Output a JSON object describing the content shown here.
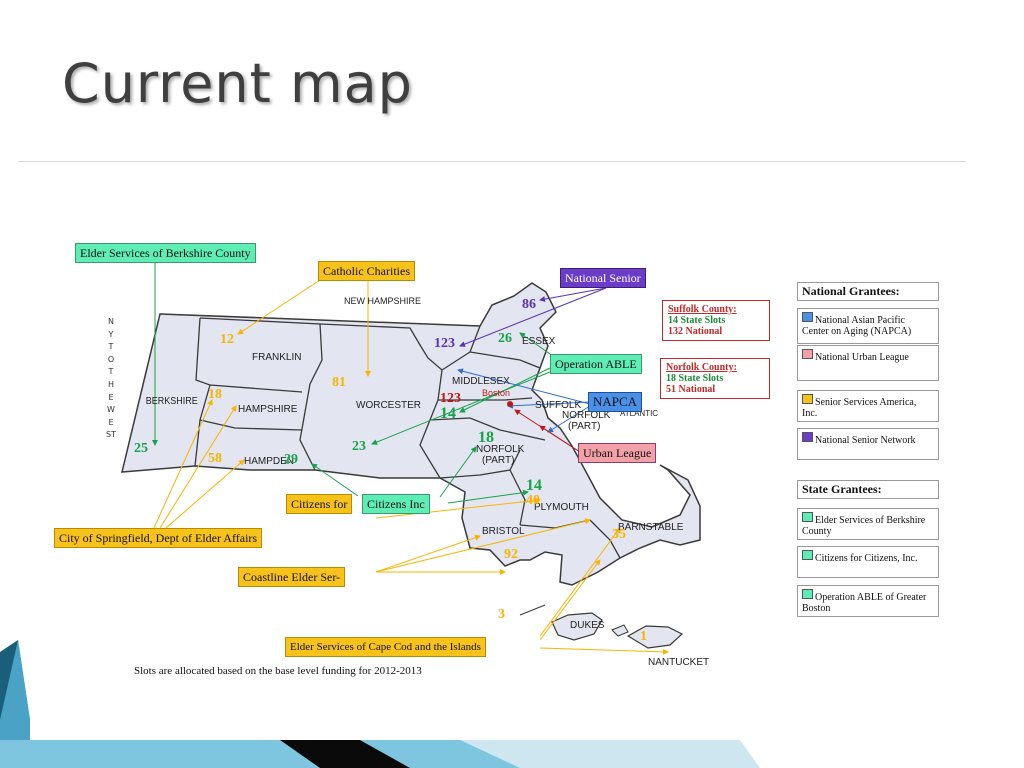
{
  "slide": {
    "title": "Current map"
  },
  "map": {
    "ny_west": "NY TO THE WEST",
    "counties": {
      "berkshire": "BERKSHIRE",
      "franklin": "FRANKLIN",
      "hampshire": "HAMPSHIRE",
      "hampden": "HAMPDEN",
      "worcester": "WORCESTER",
      "middlesex": "MIDDLESEX",
      "essex": "ESSEX",
      "suffolk": "SUFFOLK",
      "norfolk_part_top": "NORFOLK\n(PART)",
      "norfolk_part": "NORFOLK\n(PART)",
      "plymouth": "PLYMOUTH",
      "bristol": "BRISTOL",
      "barnstable": "BARNSTABLE",
      "dukes": "DUKES",
      "nantucket": "NANTUCKET"
    },
    "places": {
      "new_hampshire": "NEW HAMPSHIRE",
      "boston": "Boston",
      "atlantic": "ATLANTIC"
    },
    "numbers": {
      "berkshire": "25",
      "franklin": "12",
      "hampshire": "18",
      "hampden_58": "58",
      "hampden_29": "29",
      "worcester_81": "81",
      "worcester_23": "23",
      "essex_86": "86",
      "essex_26": "26",
      "middlesex_123_purple": "123",
      "middlesex_123_red": "123",
      "middlesex_14": "14",
      "norfolk_18": "18",
      "plymouth_14": "14",
      "plymouth_40": "40",
      "bristol": "92",
      "barnstable": "35",
      "dukes": "3",
      "nantucket": "1"
    },
    "colors": {
      "land": "#e3e5f0",
      "border": "#3a3a3a",
      "orange": "#f7b500",
      "green": "#17a34a",
      "purple": "#5a32b8",
      "red": "#c01818",
      "blue": "#2d6fd6"
    }
  },
  "labels": {
    "berkshire_elder": "Elder Services of Berkshire County",
    "catholic": "Catholic Charities",
    "national_senior": "National Senior",
    "operation_able": "Operation ABLE",
    "napca": "NAPCA",
    "urban_league": "Urban League",
    "citizens_for": "Citizens for",
    "citizens_inc": "Citizens Inc",
    "springfield": "City of Springfield, Dept of Elder Affairs",
    "coastline": "Coastline Elder Ser-",
    "cape_cod": "Elder Services of Cape Cod and the Islands"
  },
  "county_info": {
    "suffolk": {
      "heading": "Suffolk County:",
      "state": "14 State Slots",
      "national": "132 National"
    },
    "norfolk": {
      "heading": "Norfolk County:",
      "state": "18 State Slots",
      "national": "51 National"
    }
  },
  "legend": {
    "national_heading": "National Grantees:",
    "national": [
      {
        "color": "#4a90e8",
        "text": "National Asian Pacific Center on Aging (NAPCA)"
      },
      {
        "color": "#f3a0a8",
        "text": "National Urban League"
      },
      {
        "color": "#f7c21a",
        "text": "Senior Services America, Inc."
      },
      {
        "color": "#6a3cc8",
        "text": "National Senior Network"
      }
    ],
    "state_heading": "State Grantees:",
    "state": [
      {
        "color": "#5eedb4",
        "text": "Elder Services of Berkshire County"
      },
      {
        "color": "#5eedb4",
        "text": "Citizens for Citizens, Inc."
      },
      {
        "color": "#5eedb4",
        "text": "Operation ABLE of Greater Boston"
      }
    ]
  },
  "footnote": "Slots are allocated based on the base level funding for 2012-2013"
}
